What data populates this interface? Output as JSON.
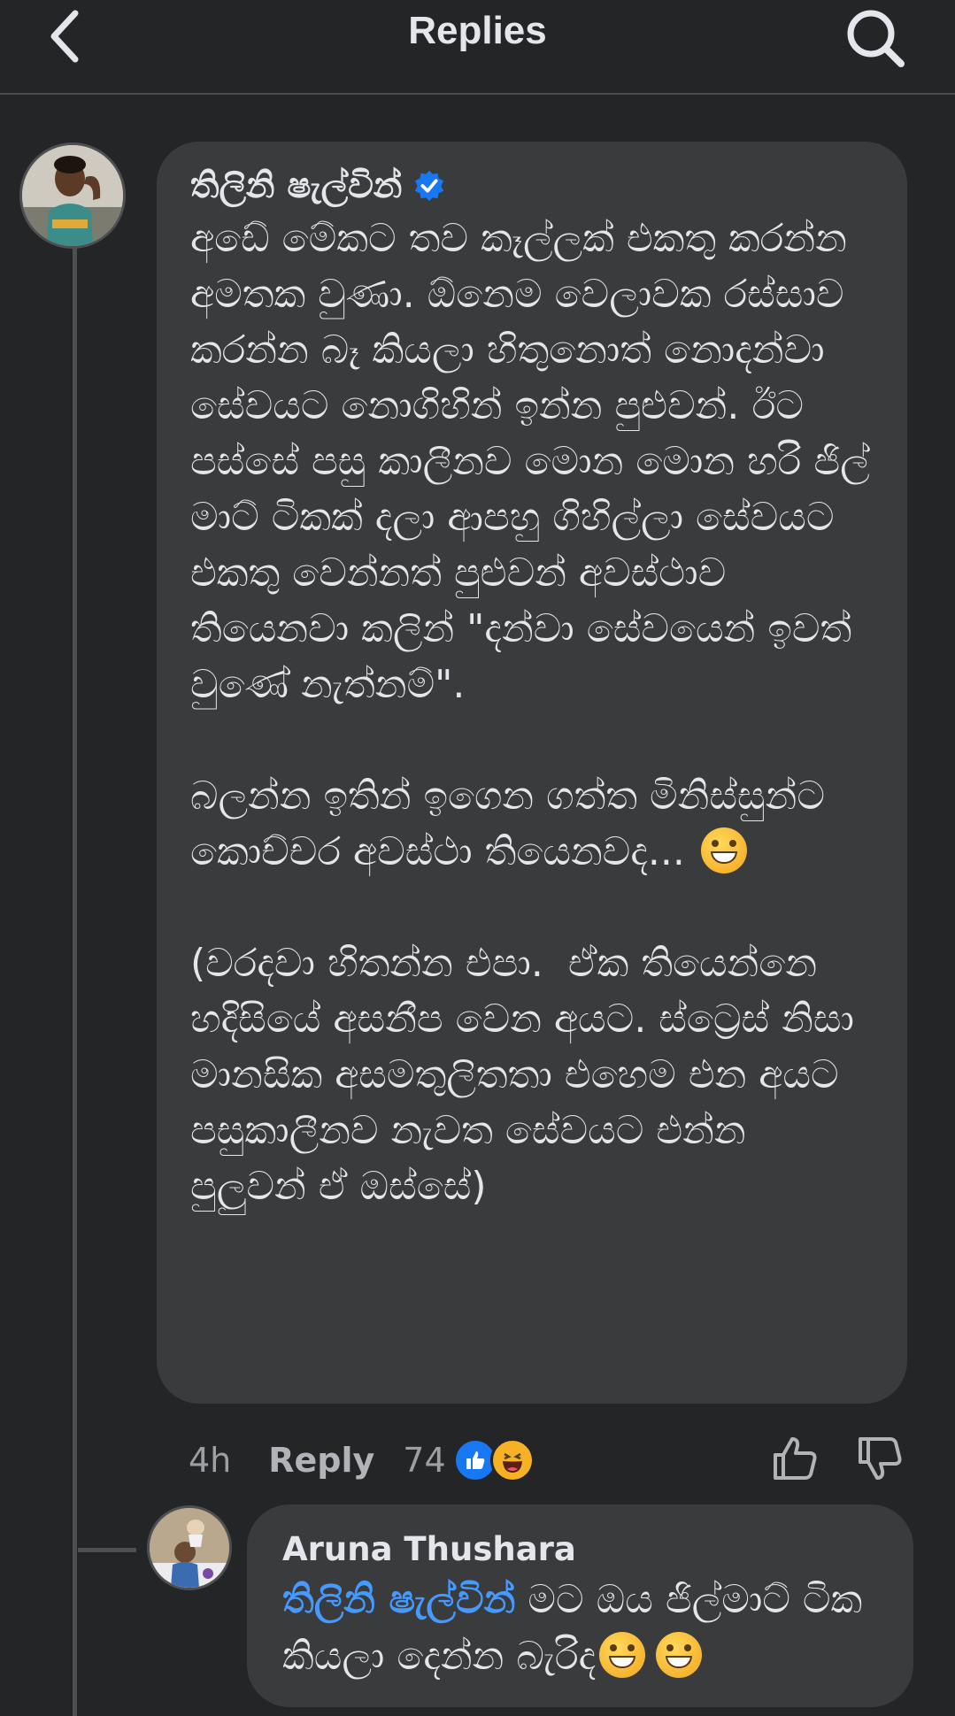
{
  "header": {
    "title": "Replies",
    "back_icon": "chevron-left-icon",
    "search_icon": "search-icon"
  },
  "comment": {
    "author": "තිලිනි ෂැල්වින්",
    "verified": true,
    "text": "අඩේ මේකට තව කෑල්ලක් එකතු කරන්න අමතක වුණා. ඕනෙම වෙලාවක රස්සාව කරන්න බෑ කියලා හිතුනොත් නොදන්වා සේවයට නොගිහින් ඉන්න පුළුවන්. ඊට පස්සේ පසු කාලීනව මොන මොන හරි ජිල් මාට් ටිකක් දලා ආපහු ගිහිල්ලා සේවයට එකතු වෙන්නත් පුළුවන් අවස්ථාව තියෙනවා කලින් \"දන්වා සේවයෙන් ඉවත් වුණේ නැත්නම්\".\n\nබලන්න ඉතින් ඉගෙන ගත්ත මිනිස්සුන්ට කොච්චර අවස්ථා තියෙනවද...",
    "text_part2": "(වරදවා හිතන්න එපා.  ඒක තියෙන්නෙ හදිසියේ අසනීප වෙන අයට. ස්ට්‍රෙස් නිසා මානසික අසමතුලිතතා එහෙම එන අයට පසුකාලීනව නැවත සේවයට එන්න පුලුවන් ඒ ඔස්සේ)",
    "time": "4h",
    "reply_label": "Reply",
    "reaction_count": "74",
    "reaction_icons": [
      "like-icon",
      "haha-icon"
    ],
    "colors": {
      "like": "#1877f2",
      "haha": "#f7b125"
    }
  },
  "reply": {
    "author": "Aruna Thushara",
    "mention": "තිලිනි ෂැල්වින්",
    "text": " මට ඔය ජිල්මාට් ටික කියලා දෙන්න බැරිද"
  }
}
